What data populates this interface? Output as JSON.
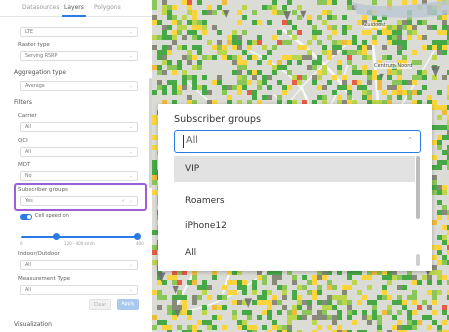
{
  "tabs": [
    {
      "label": "Datasources",
      "active": false
    },
    {
      "label": "Layers",
      "active": true
    },
    {
      "label": "Polygons",
      "active": false
    }
  ],
  "technology_select": {
    "value": "LTE"
  },
  "raster_type": {
    "label": "Raster type",
    "value": "Serving RSRP"
  },
  "aggregation_type": {
    "label": "Aggregation type",
    "value": "Average"
  },
  "filters": {
    "heading": "Filters",
    "carrier": {
      "label": "Carrier",
      "value": "All"
    },
    "qci": {
      "label": "QCI",
      "value": "All"
    },
    "mdt": {
      "label": "MDT",
      "value": "No"
    },
    "subscriber_groups": {
      "label": "Subscriber groups",
      "value": "Yes"
    },
    "cell_speed_toggle": {
      "label": "Cell speed on",
      "on": true
    },
    "speed_slider": {
      "min_label": "0",
      "range_label": "120 - 400 km/h",
      "max_label": "400"
    },
    "indoor_outdoor": {
      "label": "Indoor/Outdoor",
      "value": "All"
    },
    "measurement_type": {
      "label": "Measurement Type",
      "value": "All"
    },
    "clear_label": "Clear",
    "apply_label": "Apply"
  },
  "visualization_heading": "Visualization",
  "map_labels": {
    "place_1": "Zuidoost",
    "place_2": "Centrum Noord"
  },
  "popover": {
    "title": "Subscriber groups",
    "input_value": "All",
    "options": [
      {
        "label": "VIP",
        "highlighted": true
      },
      {
        "label": "Roamers",
        "highlighted": false
      },
      {
        "label": "iPhone12",
        "highlighted": false
      },
      {
        "label": "All",
        "highlighted": false
      }
    ]
  },
  "behind_letters": [
    "V",
    "S"
  ],
  "icons": {
    "chevron": "chevron-down-icon",
    "clear": "close-icon",
    "chevron_up": "chevron-up-icon"
  },
  "colors": {
    "accent": "#2c7be5",
    "highlight_box": "#9d5fd6",
    "map_good": "#2ca02c",
    "map_fair": "#ffd21f",
    "map_poor": "#e8452c"
  }
}
